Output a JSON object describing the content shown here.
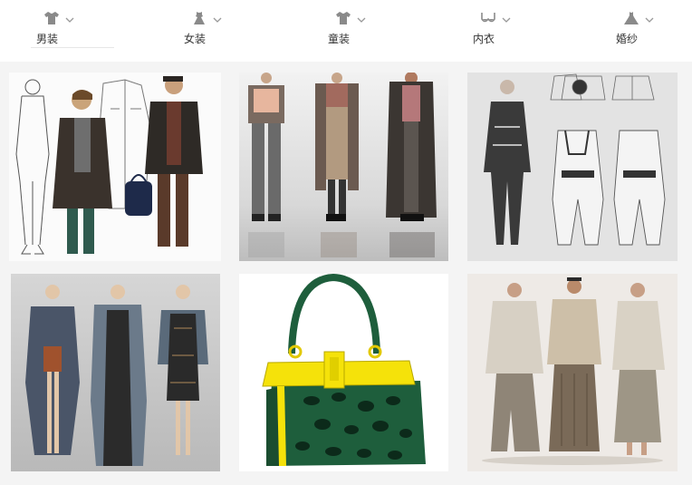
{
  "nav": {
    "items": [
      {
        "label": "男装",
        "icon": "tshirt-icon"
      },
      {
        "label": "女装",
        "icon": "dress-icon"
      },
      {
        "label": "童装",
        "icon": "kids-tshirt-icon"
      },
      {
        "label": "内衣",
        "icon": "bra-icon"
      },
      {
        "label": "婚纱",
        "icon": "wedding-dress-icon"
      }
    ]
  },
  "gallery": {
    "tiles": [
      {
        "subject": "menswear-sketch"
      },
      {
        "subject": "three-models-layered-outfits"
      },
      {
        "subject": "technical-flat-drawing"
      },
      {
        "subject": "womenswear-illustration"
      },
      {
        "subject": "green-leopard-handbag"
      },
      {
        "subject": "linen-menswear-models"
      }
    ]
  },
  "colors": {
    "icon": "#8a8a8a",
    "label": "#333333",
    "grid_bg": "#f4f4f4",
    "bag_green": "#1e5e3c",
    "bag_yellow": "#f5e20a"
  }
}
